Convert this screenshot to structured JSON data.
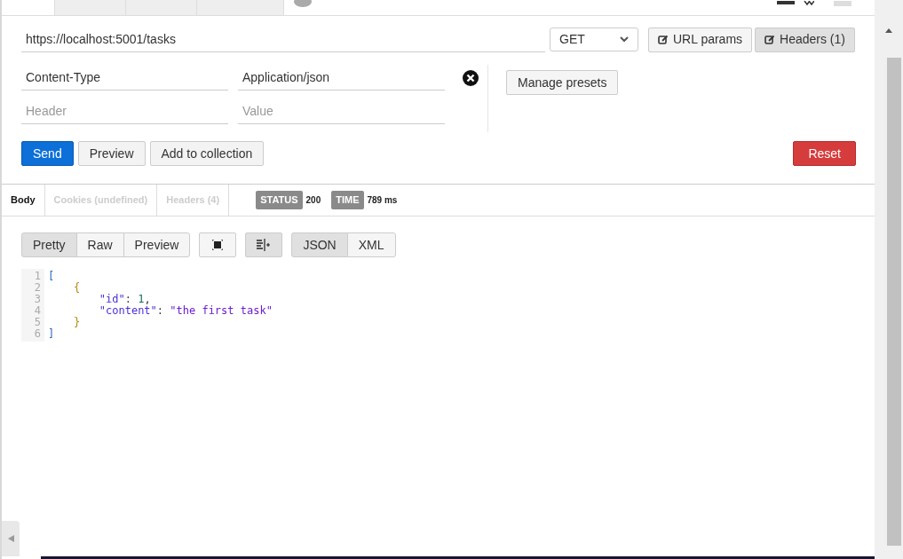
{
  "request_tabs": [
    {
      "selected": true
    },
    {
      "selected": false
    },
    {
      "selected": false
    },
    {
      "selected": false
    }
  ],
  "url": {
    "value": "https://localhost:5001/tasks"
  },
  "method": "GET",
  "url_buttons": [
    {
      "label": "URL params",
      "selected": false
    },
    {
      "label": "Headers (1)",
      "selected": true
    }
  ],
  "headers": [
    {
      "key": {
        "value": "Content-Type"
      },
      "value": {
        "value": "Application/json"
      },
      "removable": true
    },
    {
      "key": {
        "placeholder": "Header"
      },
      "value": {
        "placeholder": "Value"
      },
      "removable": false
    }
  ],
  "manage_presets": "Manage presets",
  "actions": [
    {
      "label": "Send",
      "kind": "primary"
    },
    {
      "label": "Preview",
      "kind": "default"
    },
    {
      "label": "Add to collection",
      "kind": "default"
    }
  ],
  "reset": "Reset",
  "response_tabs": [
    {
      "label": "Body",
      "selected": true
    },
    {
      "label": "Cookies (undefined)",
      "selected": false
    },
    {
      "label": "Headers (4)",
      "selected": false
    }
  ],
  "status": {
    "label": "STATUS",
    "value": "200"
  },
  "time": {
    "label": "TIME",
    "value": "789 ms"
  },
  "view_modes": [
    {
      "label": "Pretty",
      "selected": true
    },
    {
      "label": "Raw",
      "selected": false
    },
    {
      "label": "Preview",
      "selected": false
    }
  ],
  "formats": [
    {
      "label": "JSON",
      "selected": true
    },
    {
      "label": "XML",
      "selected": false
    }
  ],
  "code_lines": [
    {
      "number": "1",
      "tokens": [
        {
          "kind": "bracket",
          "text": "["
        }
      ]
    },
    {
      "number": "2",
      "tokens": [
        {
          "kind": "brace",
          "text": "    {"
        }
      ]
    },
    {
      "number": "3",
      "tokens": [
        {
          "kind": "key",
          "text": "        \"id\""
        },
        {
          "kind": "punct",
          "text": ": "
        },
        {
          "kind": "number",
          "text": "1"
        },
        {
          "kind": "punct",
          "text": ","
        }
      ]
    },
    {
      "number": "4",
      "tokens": [
        {
          "kind": "key",
          "text": "        \"content\""
        },
        {
          "kind": "punct",
          "text": ": "
        },
        {
          "kind": "string",
          "text": "\"the first task\""
        }
      ]
    },
    {
      "number": "5",
      "tokens": [
        {
          "kind": "brace",
          "text": "    }"
        }
      ]
    },
    {
      "number": "6",
      "tokens": [
        {
          "kind": "bracket",
          "text": "]"
        }
      ]
    }
  ]
}
